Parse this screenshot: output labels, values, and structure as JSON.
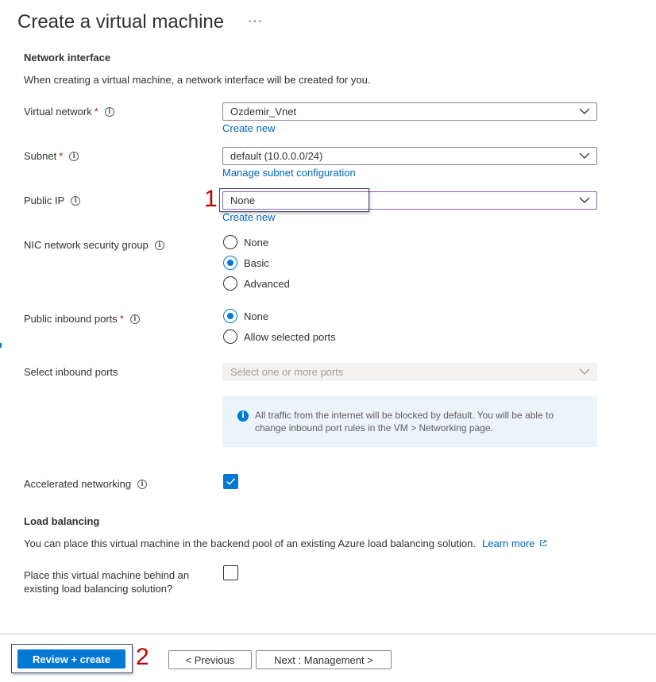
{
  "header": {
    "title": "Create a virtual machine",
    "more_glyph": "···"
  },
  "network_interface": {
    "heading": "Network interface",
    "description": "When creating a virtual machine, a network interface will be created for you.",
    "virtual_network": {
      "label": "Virtual network",
      "required": "*",
      "value": "Ozdemir_Vnet",
      "link": "Create new"
    },
    "subnet": {
      "label": "Subnet",
      "required": "*",
      "value": "default (10.0.0.0/24)",
      "link": "Manage subnet configuration"
    },
    "public_ip": {
      "label": "Public IP",
      "value": "None",
      "link": "Create new"
    },
    "nic_nsg": {
      "label": "NIC network security group",
      "options": [
        "None",
        "Basic",
        "Advanced"
      ],
      "selected": "Basic"
    },
    "public_inbound_ports": {
      "label": "Public inbound ports",
      "required": "*",
      "options": [
        "None",
        "Allow selected ports"
      ],
      "selected": "None"
    },
    "select_inbound_ports": {
      "label": "Select inbound ports",
      "placeholder": "Select one or more ports"
    },
    "info_text": "All traffic from the internet will be blocked by default. You will be able to change inbound port rules in the VM > Networking page.",
    "accelerated_networking": {
      "label": "Accelerated networking",
      "checked": true
    }
  },
  "load_balancing": {
    "heading": "Load balancing",
    "description": "You can place this virtual machine in the backend pool of an existing Azure load balancing solution.",
    "learn_more": "Learn more",
    "place_behind_label_line1": "Place this virtual machine behind an",
    "place_behind_label_line2": "existing load balancing solution?",
    "checked": false
  },
  "footer": {
    "review_create": "Review + create",
    "previous": "< Previous",
    "next": "Next : Management >"
  },
  "annotations": {
    "one": "1",
    "two": "2"
  },
  "colors": {
    "accent": "#0078d4",
    "link": "#0066b8",
    "required": "#a4262c",
    "annotation": "#c00000"
  }
}
